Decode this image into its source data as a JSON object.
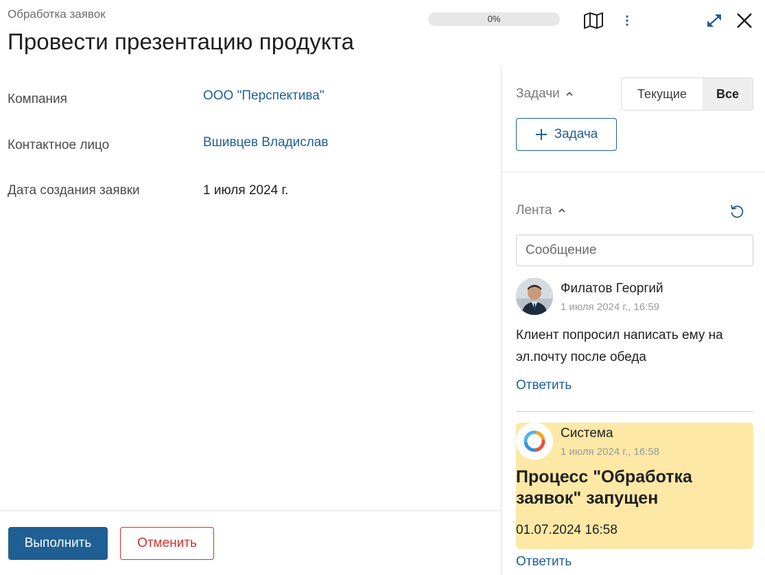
{
  "header": {
    "subtitle": "Обработка заявок",
    "title": "Провести презентацию продукта",
    "progress_value": 0,
    "progress_label": "0%"
  },
  "fields": [
    {
      "label": "Компания",
      "value": "ООО \"Перспектива\""
    },
    {
      "label": "Контактное лицо",
      "value": "Вшивцев Владислав"
    },
    {
      "label": "Дата создания заявки",
      "value": "1 июля 2024 г."
    }
  ],
  "footer": {
    "complete_label": "Выполнить",
    "cancel_label": "Отменить"
  },
  "tasks": {
    "title": "Задачи",
    "filter_current": "Текущие",
    "filter_all": "Все",
    "add_label": "Задача"
  },
  "feed": {
    "title": "Лента",
    "message_placeholder": "Сообщение",
    "entries": [
      {
        "author": "Филатов Георгий",
        "time": "1 июля 2024 г., 16:59",
        "text": "Клиент попросил написать ему на эл.почту после обеда",
        "reply_label": "Ответить"
      },
      {
        "author": "Система",
        "time": "1 июля 2024 г., 16:58",
        "title": "Процесс \"Обработка заявок\" запущен",
        "date": "01.07.2024 16:58",
        "reply_label": "Ответить"
      }
    ]
  },
  "colors": {
    "accent": "#1f5f93",
    "danger": "#d0312d",
    "system_card": "#fde8a6"
  },
  "icons": [
    "map-icon",
    "more-vertical-icon",
    "expand-icon",
    "close-icon",
    "chevron-up-icon",
    "plus-icon",
    "refresh-icon",
    "system-logo-icon"
  ]
}
